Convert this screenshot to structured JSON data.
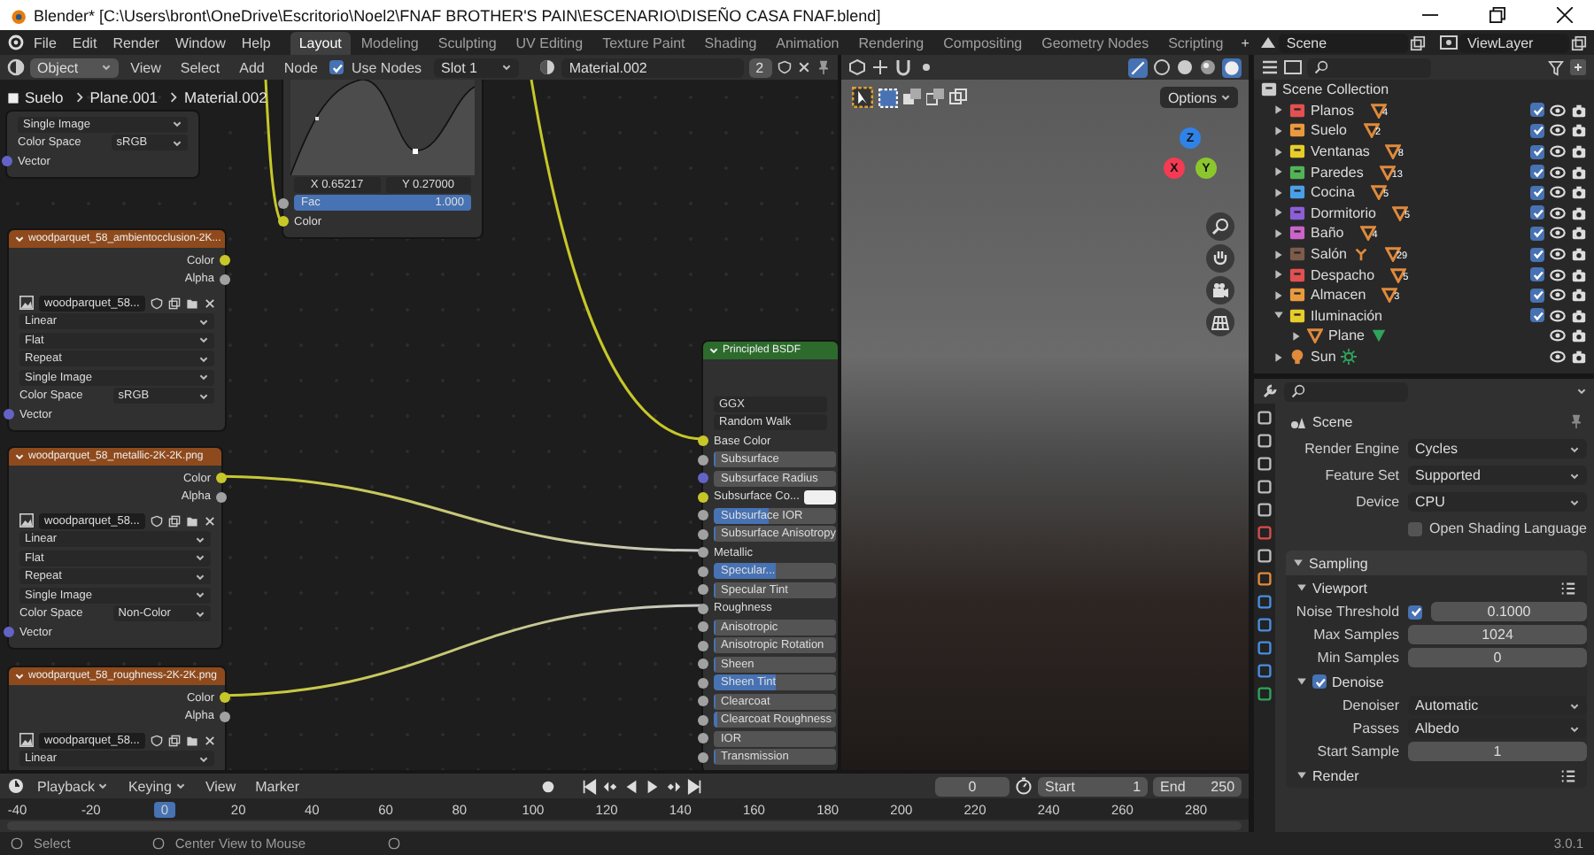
{
  "title_bar": {
    "title": "Blender* [C:\\Users\\bront\\OneDrive\\Escritorio\\Noel2\\FNAF BROTHER'S PAIN\\ESCENARIO\\DISEÑO CASA FNAF.blend]"
  },
  "menu": [
    "File",
    "Edit",
    "Render",
    "Window",
    "Help"
  ],
  "workspaces": [
    {
      "label": "Layout",
      "selected": true
    },
    {
      "label": "Modeling",
      "selected": false
    },
    {
      "label": "Sculpting",
      "selected": false
    },
    {
      "label": "UV Editing",
      "selected": false
    },
    {
      "label": "Texture Paint",
      "selected": false
    },
    {
      "label": "Shading",
      "selected": false
    },
    {
      "label": "Animation",
      "selected": false
    },
    {
      "label": "Rendering",
      "selected": false
    },
    {
      "label": "Compositing",
      "selected": false
    },
    {
      "label": "Geometry Nodes",
      "selected": false
    },
    {
      "label": "Scripting",
      "selected": false
    }
  ],
  "add_workspace": "+",
  "scene": "Scene",
  "view_layer": "ViewLayer",
  "node_editor": {
    "mode": "Object",
    "menus": [
      "View",
      "Select",
      "Add",
      "Node"
    ],
    "use_nodes": {
      "label": "Use Nodes",
      "checked": true
    },
    "slot": "Slot 1",
    "material": "Material.002",
    "users": "2",
    "breadcrumbs": [
      "Suelo",
      "Plane.001",
      "Material.002"
    ],
    "nodes": [
      {
        "kind": "image",
        "options": [
          "Single Image"
        ],
        "color_space": {
          "label": "Color Space",
          "value": "sRGB"
        },
        "inputs": [
          {
            "label": "Vector",
            "color": "#6363c7"
          }
        ]
      },
      {
        "kind": "curve",
        "point_x": "X 0.65217",
        "point_y": "Y 0.27000",
        "fac": {
          "label": "Fac",
          "value": "1.000",
          "level": 1,
          "color": "#a1a1a1"
        },
        "inputs": [
          {
            "label": "Color",
            "color": "#c7c729"
          }
        ]
      },
      {
        "kind": "image",
        "title": "woodparquet_58_ambientocclusion-2K...",
        "outputs": [
          {
            "label": "Color",
            "color": "#c7c729"
          },
          {
            "label": "Alpha",
            "color": "#a1a1a1"
          }
        ],
        "image": "woodparquet_58...",
        "options": [
          "Linear",
          "Flat",
          "Repeat",
          "Single Image"
        ],
        "color_space": {
          "label": "Color Space",
          "value": "sRGB"
        },
        "inputs": [
          {
            "label": "Vector",
            "color": "#6363c7"
          }
        ]
      },
      {
        "kind": "image",
        "title": "woodparquet_58_metallic-2K-2K.png",
        "outputs": [
          {
            "label": "Color",
            "color": "#c7c729"
          },
          {
            "label": "Alpha",
            "color": "#a1a1a1"
          }
        ],
        "image": "woodparquet_58...",
        "options": [
          "Linear",
          "Flat",
          "Repeat",
          "Single Image"
        ],
        "color_space": {
          "label": "Color Space",
          "value": "Non-Color"
        },
        "inputs": [
          {
            "label": "Vector",
            "color": "#6363c7"
          }
        ]
      },
      {
        "kind": "image",
        "title": "woodparquet_58_roughness-2K-2K.png",
        "outputs": [
          {
            "label": "Color",
            "color": "#c7c729"
          },
          {
            "label": "Alpha",
            "color": "#a1a1a1"
          }
        ],
        "image": "woodparquet_58...",
        "options": [
          "Linear"
        ]
      },
      {
        "kind": "bsdf",
        "title": "Principled BSDF",
        "options": [
          "GGX",
          "Random Walk"
        ],
        "sockets": [
          {
            "label": "Base Color",
            "kind": "linked",
            "color": "#c7c729"
          },
          {
            "label": "Subsurface",
            "kind": "slider",
            "level": 0,
            "color": "#a1a1a1"
          },
          {
            "label": "Subsurface Radius",
            "kind": "field",
            "color": "#6363c7"
          },
          {
            "label": "Subsurface Co...",
            "kind": "swatch",
            "color": "#c7c729"
          },
          {
            "label": "Subsurface IOR",
            "kind": "slider",
            "level": 0.45,
            "color": "#a1a1a1"
          },
          {
            "label": "Subsurface Anisotropy",
            "kind": "slider",
            "level": 0,
            "color": "#a1a1a1"
          },
          {
            "label": "Metallic",
            "kind": "linked",
            "color": "#a1a1a1"
          },
          {
            "label": "Specular...",
            "kind": "slider",
            "level": 0.5,
            "color": "#a1a1a1"
          },
          {
            "label": "Specular Tint",
            "kind": "slider",
            "level": 0,
            "color": "#a1a1a1"
          },
          {
            "label": "Roughness",
            "kind": "linked",
            "color": "#a1a1a1"
          },
          {
            "label": "Anisotropic",
            "kind": "slider",
            "level": 0,
            "color": "#a1a1a1"
          },
          {
            "label": "Anisotropic Rotation",
            "kind": "slider",
            "level": 0,
            "color": "#a1a1a1"
          },
          {
            "label": "Sheen",
            "kind": "slider",
            "level": 0,
            "color": "#a1a1a1"
          },
          {
            "label": "Sheen Tint",
            "kind": "slider",
            "level": 0.5,
            "color": "#a1a1a1"
          },
          {
            "label": "Clearcoat",
            "kind": "slider",
            "level": 0,
            "color": "#a1a1a1"
          },
          {
            "label": "Clearcoat Roughness",
            "kind": "slider",
            "level": 0.03,
            "color": "#a1a1a1"
          },
          {
            "label": "IOR",
            "kind": "field",
            "color": "#a1a1a1"
          },
          {
            "label": "Transmission",
            "kind": "slider",
            "level": 0,
            "color": "#a1a1a1"
          }
        ]
      }
    ]
  },
  "viewport": {
    "options": "Options",
    "gizmo": [
      "Z",
      "X",
      "Y"
    ]
  },
  "outliner": {
    "root": "Scene Collection",
    "items": [
      {
        "name": "Planos",
        "kind": "collection",
        "color": "#e25050",
        "count": "4",
        "checked": true,
        "expanded": false
      },
      {
        "name": "Suelo",
        "kind": "collection",
        "color": "#ea9a3e",
        "count": "2",
        "checked": true,
        "expanded": false
      },
      {
        "name": "Ventanas",
        "kind": "collection",
        "color": "#e6cd2a",
        "count": "8",
        "checked": true,
        "expanded": false
      },
      {
        "name": "Paredes",
        "kind": "collection",
        "color": "#52b455",
        "count": "13",
        "checked": true,
        "expanded": false
      },
      {
        "name": "Cocina",
        "kind": "collection",
        "color": "#4aa0e8",
        "count": "5",
        "checked": true,
        "expanded": false
      },
      {
        "name": "Dormitorio",
        "kind": "collection",
        "color": "#8c5fd8",
        "count": "5",
        "checked": true,
        "expanded": false
      },
      {
        "name": "Baño",
        "kind": "collection",
        "color": "#cc63c9",
        "count": "4",
        "checked": true,
        "expanded": false
      },
      {
        "name": "Salón",
        "kind": "collection",
        "color": "#7d5b4a",
        "count": "29",
        "armature": true,
        "checked": true,
        "expanded": false
      },
      {
        "name": "Despacho",
        "kind": "collection",
        "color": "#e25050",
        "count": "5",
        "checked": true,
        "expanded": false
      },
      {
        "name": "Almacen",
        "kind": "collection",
        "color": "#ea9a3e",
        "count": "3",
        "checked": true,
        "expanded": false
      },
      {
        "name": "Iluminación",
        "kind": "collection",
        "color": "#e6cd2a",
        "checked": true,
        "expanded": true,
        "children": [
          {
            "name": "Plane",
            "kind": "mesh",
            "expanded": false
          }
        ]
      },
      {
        "name": "Sun",
        "kind": "light",
        "expanded": false
      }
    ]
  },
  "properties": {
    "context": "Scene",
    "fields": [
      {
        "kind": "dropdown",
        "label": "Render Engine",
        "value": "Cycles"
      },
      {
        "kind": "dropdown",
        "label": "Feature Set",
        "value": "Supported"
      },
      {
        "kind": "dropdown",
        "label": "Device",
        "value": "CPU"
      },
      {
        "kind": "checkbox",
        "label": "Open Shading Language",
        "checked": false
      }
    ],
    "panels": [
      {
        "title": "Sampling",
        "expanded": true,
        "subpanels": [
          {
            "title": "Viewport",
            "expanded": true,
            "rows": [
              {
                "kind": "check_number",
                "label": "Noise Threshold",
                "checked": true,
                "value": "0.1000"
              },
              {
                "kind": "number",
                "label": "Max Samples",
                "value": "1024"
              },
              {
                "kind": "number",
                "label": "Min Samples",
                "value": "0"
              }
            ]
          },
          {
            "title": "Denoise",
            "expanded": true,
            "checked": true,
            "rows": [
              {
                "kind": "dropdown",
                "label": "Denoiser",
                "value": "Automatic"
              },
              {
                "kind": "dropdown",
                "label": "Passes",
                "value": "Albedo"
              },
              {
                "kind": "number",
                "label": "Start Sample",
                "value": "1"
              }
            ]
          },
          {
            "title": "Render",
            "expanded": true
          }
        ]
      }
    ]
  },
  "timeline": {
    "menus": [
      {
        "label": "Playback",
        "dropdown": true
      },
      {
        "label": "Keying",
        "dropdown": true
      },
      {
        "label": "View",
        "dropdown": false
      },
      {
        "label": "Marker",
        "dropdown": false
      }
    ],
    "frame": "0",
    "start": {
      "label": "Start",
      "value": "1"
    },
    "end": {
      "label": "End",
      "value": "250"
    },
    "ruler": [
      {
        "label": "-40",
        "selected": false
      },
      {
        "label": "-20",
        "selected": false
      },
      {
        "label": "0",
        "selected": true
      },
      {
        "label": "20",
        "selected": false
      },
      {
        "label": "40",
        "selected": false
      },
      {
        "label": "60",
        "selected": false
      },
      {
        "label": "80",
        "selected": false
      },
      {
        "label": "100",
        "selected": false
      },
      {
        "label": "120",
        "selected": false
      },
      {
        "label": "140",
        "selected": false
      },
      {
        "label": "160",
        "selected": false
      },
      {
        "label": "180",
        "selected": false
      },
      {
        "label": "200",
        "selected": false
      },
      {
        "label": "220",
        "selected": false
      },
      {
        "label": "240",
        "selected": false
      },
      {
        "label": "260",
        "selected": false
      },
      {
        "label": "280",
        "selected": false
      }
    ]
  },
  "status_bar": {
    "hints": [
      "Select",
      "Center View to Mouse"
    ],
    "version": "3.0.1"
  }
}
